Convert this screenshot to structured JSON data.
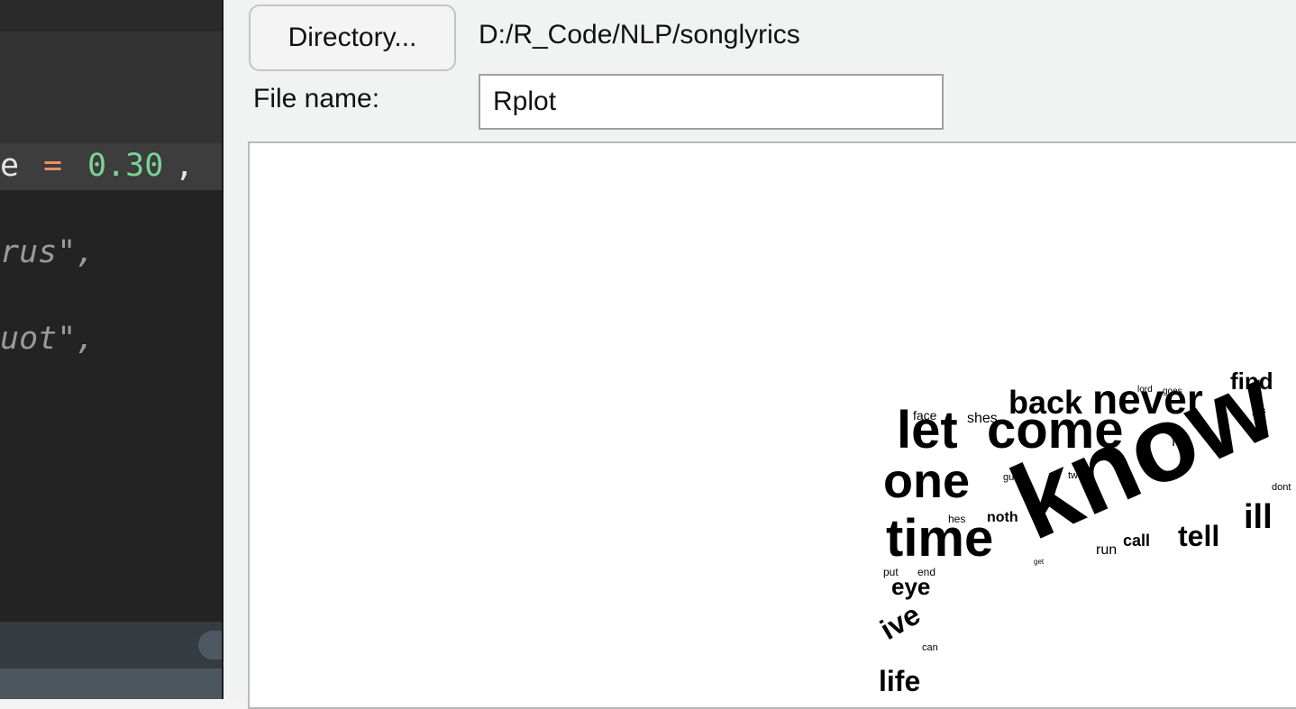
{
  "editor": {
    "lines": [
      {
        "text": "e",
        "color": "#e6e6e6",
        "italic": false
      },
      {
        "text": "=",
        "color": "#f28f66",
        "italic": false
      },
      {
        "text": "0.30",
        "color": "#78d496",
        "italic": false
      },
      {
        "text": ",",
        "color": "#e6e6e6",
        "italic": false
      },
      {
        "text": "rus\",",
        "color": "#9a9a9a",
        "italic": true
      },
      {
        "text": "uot\",",
        "color": "#9a9a9a",
        "italic": true
      }
    ]
  },
  "dialog": {
    "directory_button": "Directory...",
    "directory_path": "D:/R_Code/NLP/songlyrics",
    "filename_label": "File name:",
    "filename_value": "Rplot"
  },
  "wordcloud": {
    "words": [
      "know",
      "let",
      "come",
      "one",
      "time",
      "back",
      "never",
      "find",
      "tell",
      "ill",
      "eye",
      "ive",
      "life",
      "face",
      "shes",
      "fall",
      "call",
      "run",
      "noth",
      "hes",
      "gun",
      "two",
      "put",
      "end",
      "lord",
      "goes",
      "yes",
      "dont",
      "get",
      "can"
    ]
  }
}
